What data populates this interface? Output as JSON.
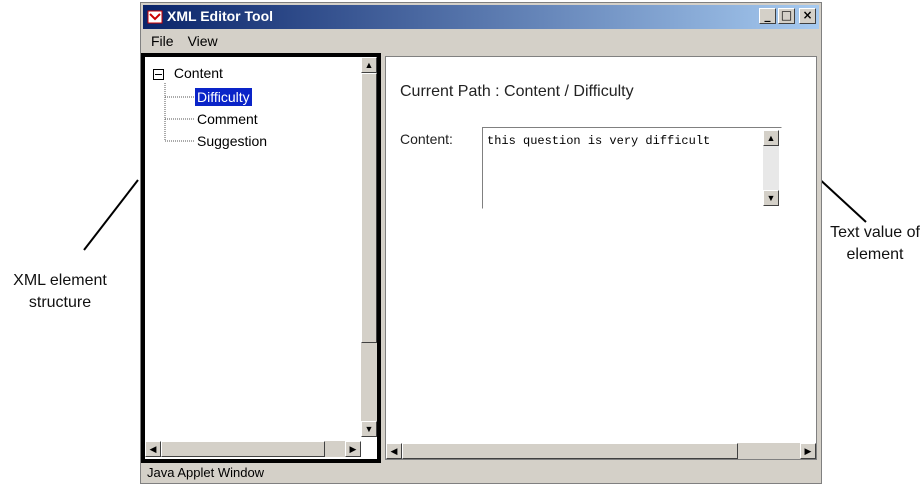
{
  "window": {
    "title": "XML Editor Tool",
    "buttons": [
      "_",
      "□",
      "×"
    ],
    "status_text": "Java Applet Window"
  },
  "menu": [
    "File",
    "View"
  ],
  "tree": {
    "root": "Content",
    "children": [
      "Difficulty",
      "Comment",
      "Suggestion"
    ],
    "selected": "Difficulty"
  },
  "detail": {
    "path_label": "Current Path : Content / Difficulty",
    "content_label": "Content:",
    "content_value": "this question is very difficult"
  },
  "annotations": {
    "left": "XML element structure",
    "right": "Text value of element"
  }
}
